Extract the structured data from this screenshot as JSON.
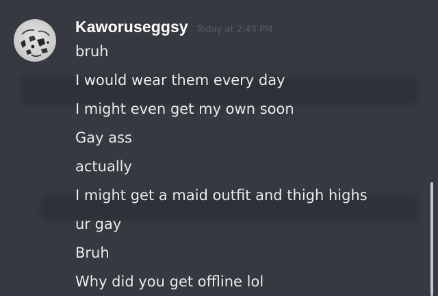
{
  "message_group": {
    "username": "Kaworuseggsy",
    "timestamp": "Today at 2:49 PM",
    "messages": [
      "bruh",
      "I would wear them every day",
      "I might even get my own soon",
      "Gay ass",
      "actually",
      "I might get a maid outfit and thigh highs",
      "ur gay",
      "Bruh",
      "Why did you get offline lol"
    ]
  },
  "colors": {
    "background": "#36393f",
    "username": "#ffffff",
    "message_text": "#e9eaeb",
    "timestamp": "#72767d"
  },
  "icons": {
    "avatar": "user-avatar-image"
  }
}
